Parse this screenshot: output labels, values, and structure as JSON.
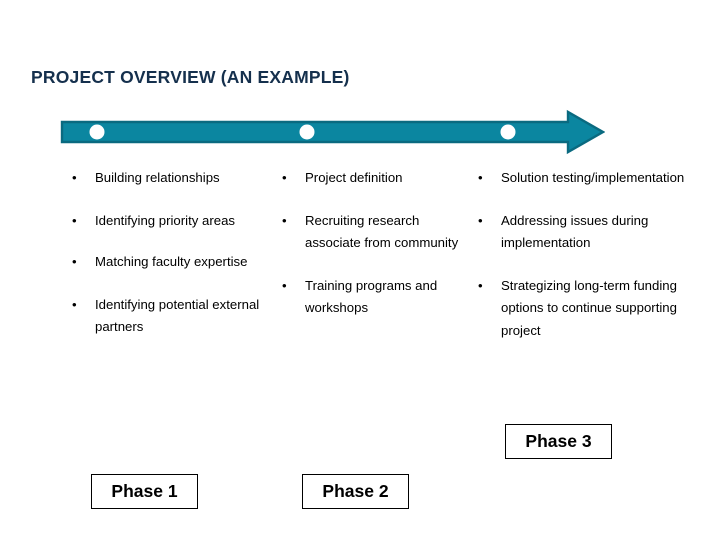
{
  "slide": {
    "title": "PROJECT OVERVIEW (AN EXAMPLE)",
    "title_color": "#15304d",
    "background_color": "#ffffff"
  },
  "timeline": {
    "name": "phase-timeline-arrow",
    "arrow_color": "#0b86a0",
    "arrow_outline_color": "#0a6a80",
    "marker_color": "#ffffff",
    "marker_count": 3,
    "direction": "right"
  },
  "columns": [
    {
      "id": "column-1",
      "phase_label": "Phase 1",
      "bullet_glyph": "•",
      "items": [
        "Building relationships",
        "Identifying priority areas",
        "Matching faculty expertise",
        "Identifying potential external partners"
      ]
    },
    {
      "id": "column-2",
      "phase_label": "Phase 2",
      "bullet_glyph": "•",
      "items": [
        "Project definition",
        "Recruiting research associate from community",
        "Training programs and workshops"
      ]
    },
    {
      "id": "column-3",
      "phase_label": "Phase 3",
      "bullet_glyph": "•",
      "items": [
        "Solution testing/implementation",
        "Addressing issues during implementation",
        "Strategizing long-term funding options to continue supporting project"
      ]
    }
  ],
  "phase_boxes": [
    {
      "label": "Phase 1"
    },
    {
      "label": "Phase 2"
    },
    {
      "label": "Phase 3"
    }
  ]
}
